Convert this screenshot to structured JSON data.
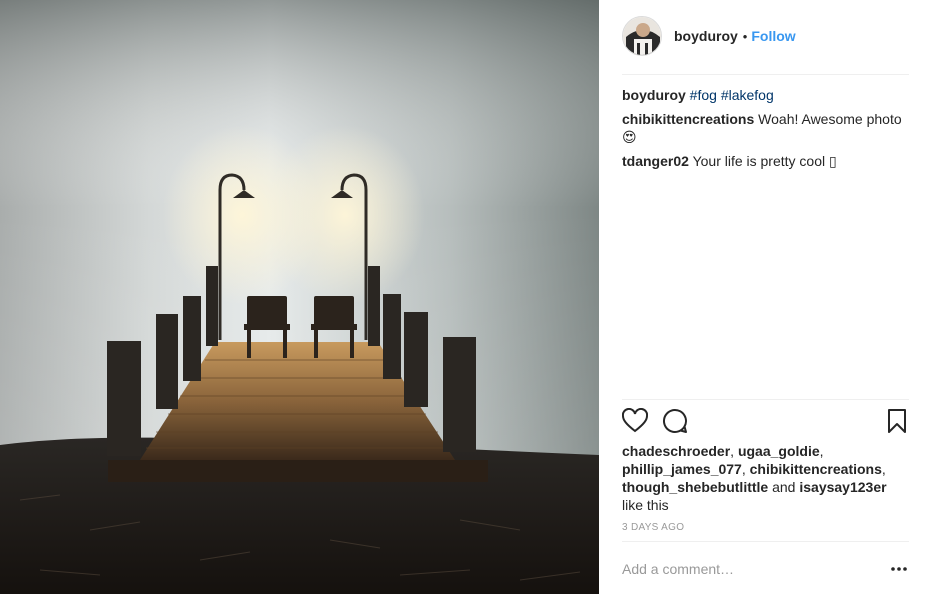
{
  "post": {
    "username": "boyduroy",
    "separator": "•",
    "follow_label": "Follow"
  },
  "comments": [
    {
      "author": "boyduroy",
      "text": "",
      "tags": [
        "#fog",
        "#lakefog"
      ]
    },
    {
      "author": "chibikittencreations",
      "text": "Woah! Awesome photo",
      "emoji": "😍"
    },
    {
      "author": "tdanger02",
      "text": "Your life is pretty cool ",
      "emoji": "▯"
    }
  ],
  "actions": {
    "like_icon": "heart-icon",
    "comment_icon": "speech-bubble-icon",
    "save_icon": "bookmark-icon"
  },
  "likes": {
    "likers": [
      "chadeschroeder",
      "ugaa_goldie",
      "phillip_james_077",
      "chibikittencreations",
      "though_shebebutlittle",
      "isaysay123er"
    ],
    "sep_comma": ", ",
    "sep_and": " and ",
    "suffix": " like this"
  },
  "timestamp": "3 days ago",
  "add_comment": {
    "placeholder": "Add a comment…",
    "more_icon": "more-options-icon"
  },
  "colors": {
    "link": "#3897f0",
    "hashtag": "#003569",
    "muted": "#999999",
    "text": "#262626"
  }
}
